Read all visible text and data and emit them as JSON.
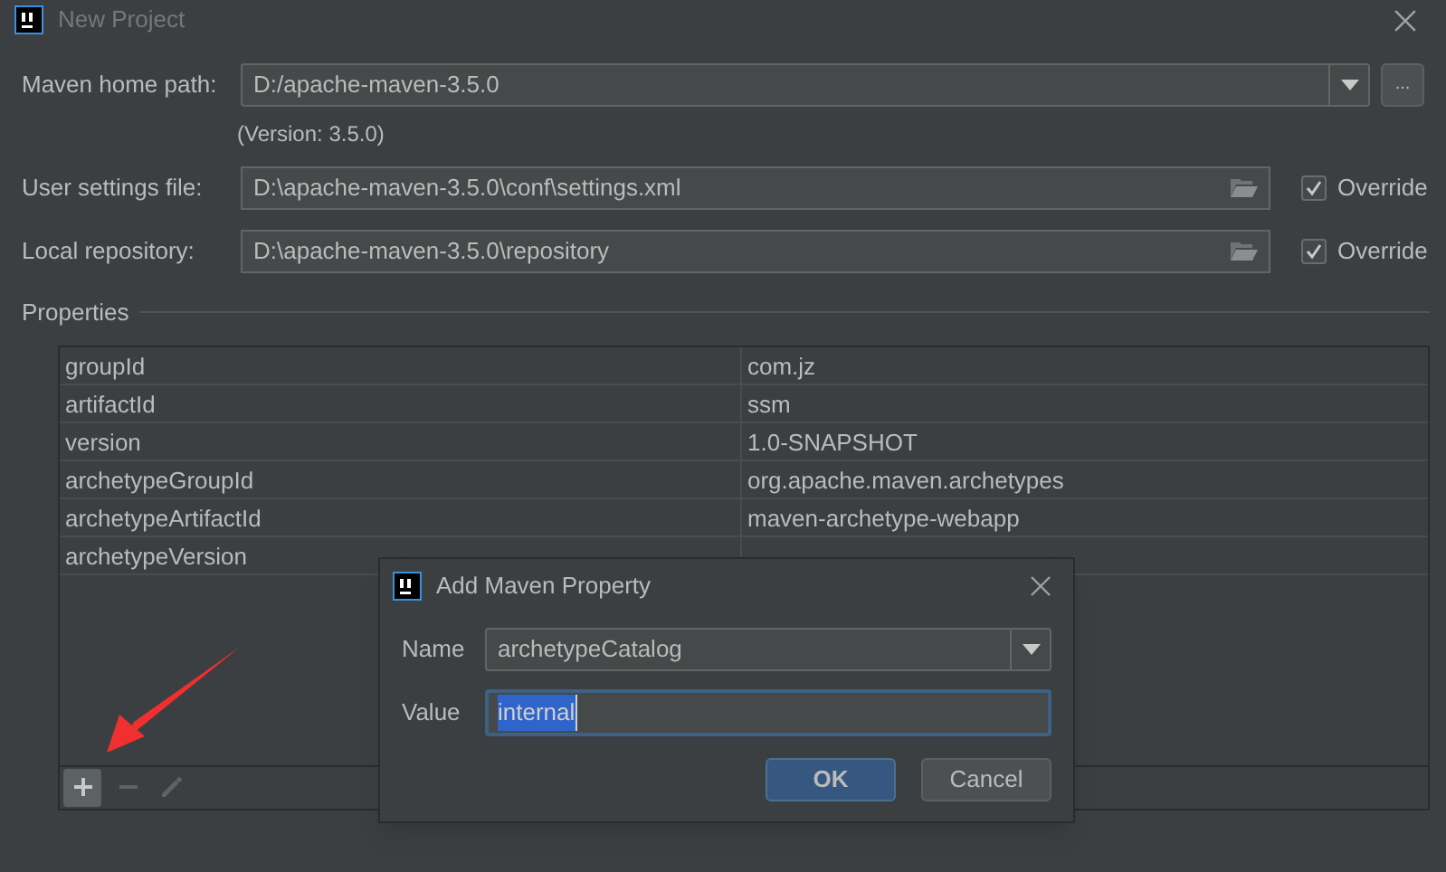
{
  "window": {
    "title": "New Project"
  },
  "maven_home": {
    "label": "Maven home path:",
    "value": "D:/apache-maven-3.5.0",
    "version": "(Version: 3.5.0)",
    "browse_button": "..."
  },
  "settings": [
    {
      "label": "User settings file:",
      "value": "D:\\apache-maven-3.5.0\\conf\\settings.xml",
      "override": {
        "label": "Override",
        "checked": true
      }
    },
    {
      "label": "Local repository:",
      "value": "D:\\apache-maven-3.5.0\\repository",
      "override": {
        "label": "Override",
        "checked": true
      }
    }
  ],
  "properties": {
    "title": "Properties",
    "rows": [
      {
        "key": "groupId",
        "value": "com.jz"
      },
      {
        "key": "artifactId",
        "value": "ssm"
      },
      {
        "key": "version",
        "value": "1.0-SNAPSHOT"
      },
      {
        "key": "archetypeGroupId",
        "value": "org.apache.maven.archetypes"
      },
      {
        "key": "archetypeArtifactId",
        "value": "maven-archetype-webapp"
      },
      {
        "key": "archetypeVersion"
      }
    ],
    "toolbar": [
      {
        "kind": "add",
        "disabled": false
      },
      {
        "kind": "remove",
        "disabled": true
      },
      {
        "kind": "edit",
        "disabled": true
      }
    ]
  },
  "dialog": {
    "title": "Add Maven Property",
    "name_label": "Name",
    "name_value": "archetypeCatalog",
    "value_label": "Value",
    "value_value": "internal",
    "ok": "OK",
    "cancel": "Cancel"
  }
}
